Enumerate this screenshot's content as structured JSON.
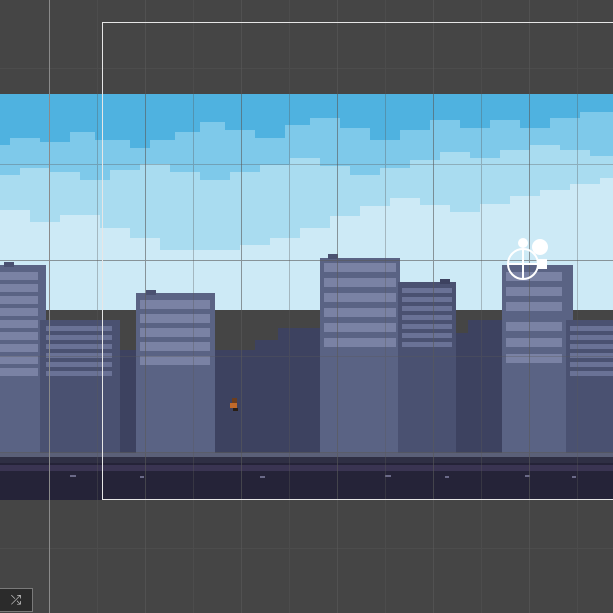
{
  "editor": {
    "background": "#454545",
    "grid_color": "#5a5a5a",
    "camera_frame_color": "#e6e6e6"
  },
  "scene": {
    "sky_colors": [
      "#4fb2e0",
      "#7ec9ea",
      "#a9dcf0",
      "#cdeaf6"
    ],
    "building_colors": [
      "#5a6384",
      "#4a5171",
      "#3d4260"
    ],
    "street_color": "#252338"
  },
  "toolbar": {
    "toggle_icon": "shuffle-icon",
    "toggle_glyph": "⤮"
  }
}
